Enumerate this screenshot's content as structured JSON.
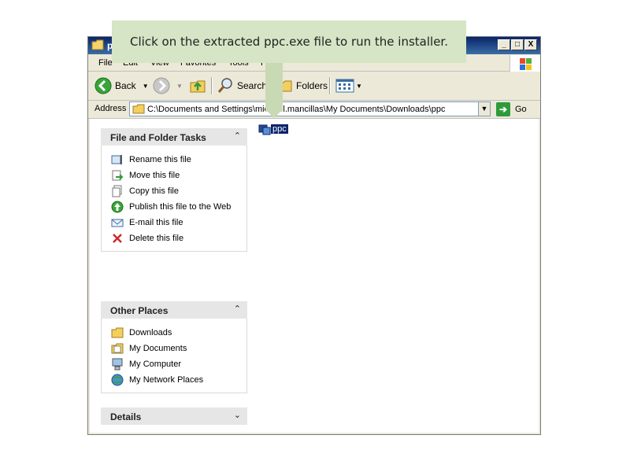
{
  "window": {
    "title": "ppc",
    "controls": [
      "_",
      "□",
      "X"
    ]
  },
  "menu": {
    "items": [
      "File",
      "Edit",
      "View",
      "Favorites",
      "Tools",
      "Help"
    ]
  },
  "toolbar": {
    "back_label": "Back",
    "search_label": "Search",
    "folders_label": "Folders"
  },
  "address": {
    "label": "Address",
    "path": "C:\\Documents and Settings\\michael.mancillas\\My Documents\\Downloads\\ppc",
    "go_label": "Go"
  },
  "file_tasks": {
    "title": "File and Folder Tasks",
    "items": [
      {
        "label": "Rename this file",
        "icon": "rename-icon"
      },
      {
        "label": "Move this file",
        "icon": "move-icon"
      },
      {
        "label": "Copy this file",
        "icon": "copy-icon"
      },
      {
        "label": "Publish this file to the Web",
        "icon": "publish-web-icon"
      },
      {
        "label": "E-mail this file",
        "icon": "email-icon"
      },
      {
        "label": "Delete this file",
        "icon": "delete-icon"
      }
    ]
  },
  "other_places": {
    "title": "Other Places",
    "items": [
      {
        "label": "Downloads",
        "icon": "folder-icon"
      },
      {
        "label": "My Documents",
        "icon": "my-documents-icon"
      },
      {
        "label": "My Computer",
        "icon": "my-computer-icon"
      },
      {
        "label": "My Network Places",
        "icon": "network-places-icon"
      }
    ]
  },
  "details": {
    "title": "Details"
  },
  "file": {
    "name": "ppc"
  },
  "callout": {
    "text": "Click on the extracted ppc.exe file to run the installer."
  },
  "colors": {
    "callout_bg": "#d5e5c5",
    "selection": "#0a246a",
    "panel_header": "#e6e6e6"
  }
}
